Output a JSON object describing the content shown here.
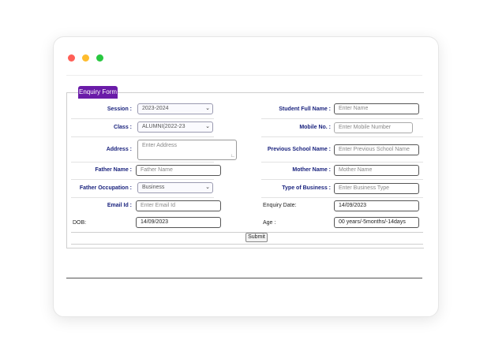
{
  "form": {
    "legend": "Enquiry Form",
    "submit_label": "Submit",
    "left": {
      "session": {
        "label": "Session :",
        "value": "2023-2024"
      },
      "class": {
        "label": "Class :",
        "value": "ALUMNI(2022-23"
      },
      "address": {
        "label": "Address :",
        "placeholder": "Enter Address"
      },
      "father_name": {
        "label": "Father Name :",
        "placeholder": "Father Name"
      },
      "father_occupation": {
        "label": "Father Occupation :",
        "value": "Business"
      },
      "email": {
        "label": "Email Id :",
        "placeholder": "Enter Email Id"
      },
      "dob": {
        "label": "DOB:",
        "value": "14/09/2023"
      }
    },
    "right": {
      "student_name": {
        "label": "Student Full Name :",
        "placeholder": "Enter Name"
      },
      "mobile": {
        "label": "Mobile No. :",
        "placeholder": "Enter Mobile Number"
      },
      "previous_school": {
        "label": "Previous School Name :",
        "placeholder": "Enter Previous School Name"
      },
      "mother_name": {
        "label": "Mother Name :",
        "placeholder": "Mother Name"
      },
      "business_type": {
        "label": "Type of Business :",
        "placeholder": "Enter Business Type"
      },
      "enquiry_date": {
        "label": "Enquiry Date:",
        "value": "14/09/2023"
      },
      "age": {
        "label": "Age :",
        "value": "00 years/-5months/-14days"
      }
    }
  },
  "colors": {
    "legend_bg": "#6a1ba8",
    "label_text": "#1a237e"
  }
}
